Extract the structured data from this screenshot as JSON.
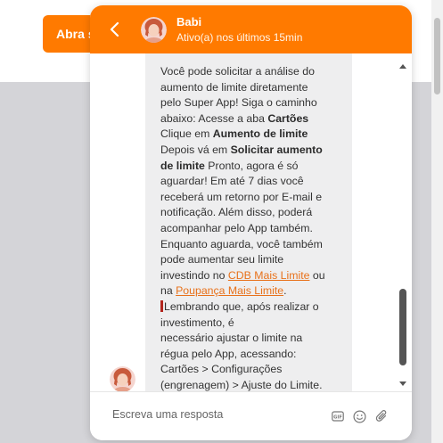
{
  "background": {
    "cta_label": "Abra sua conta"
  },
  "chat": {
    "agent_name": "Babi",
    "agent_status": "Ativo(a) nos últimos 15min",
    "message_lines": [
      [
        {
          "t": "Você pode solicitar a análise do"
        }
      ],
      [
        {
          "t": "aumento de limite diretamente"
        }
      ],
      [
        {
          "t": "pelo Super App! Siga o caminho"
        }
      ],
      [
        {
          "t": "abaixo: Acesse a aba "
        },
        {
          "t": "Cartões",
          "b": true
        }
      ],
      [
        {
          "t": "Clique em "
        },
        {
          "t": "Aumento de limite",
          "b": true
        }
      ],
      [
        {
          "t": "Depois vá em "
        },
        {
          "t": "Solicitar aumento",
          "b": true
        }
      ],
      [
        {
          "t": "de limite",
          "b": true
        },
        {
          "t": " Pronto, agora é só"
        }
      ],
      [
        {
          "t": "aguardar! Em até 7 dias você"
        }
      ],
      [
        {
          "t": "receberá um retorno por E-mail e"
        }
      ],
      [
        {
          "t": "notificação. Além disso, poderá"
        }
      ],
      [
        {
          "t": "acompanhar pelo App também."
        }
      ],
      [
        {
          "t": "Enquanto aguarda, você também"
        }
      ],
      [
        {
          "t": "pode aumentar seu limite"
        }
      ],
      [
        {
          "t": "investindo no "
        },
        {
          "t": "CDB Mais Limite",
          "a": true
        },
        {
          "t": " ou"
        }
      ],
      [
        {
          "t": "na "
        },
        {
          "t": "Poupança Mais Limite",
          "a": true
        },
        {
          "t": "."
        }
      ],
      [
        {
          "t": "",
          "pin": true
        },
        {
          "t": "Lembrando que, após realizar o"
        }
      ],
      [
        {
          "t": "investimento, é"
        }
      ],
      [
        {
          "t": "necessário ajustar o limite na"
        }
      ],
      [
        {
          "t": "régua pelo App, acessando:"
        }
      ],
      [
        {
          "t": "Cartões > Configurações"
        }
      ],
      [
        {
          "t": "(engrenagem) > Ajuste do Limite."
        }
      ]
    ],
    "reply_placeholder": "Escreva uma resposta",
    "icons": {
      "back": "chevron-left-icon",
      "gif": "gif-icon",
      "emoji": "emoji-icon",
      "attach": "paperclip-icon"
    }
  },
  "colors": {
    "brand_orange": "#ff7a00",
    "link_orange": "#e8711a",
    "bubble_gray": "#eeeeef"
  }
}
